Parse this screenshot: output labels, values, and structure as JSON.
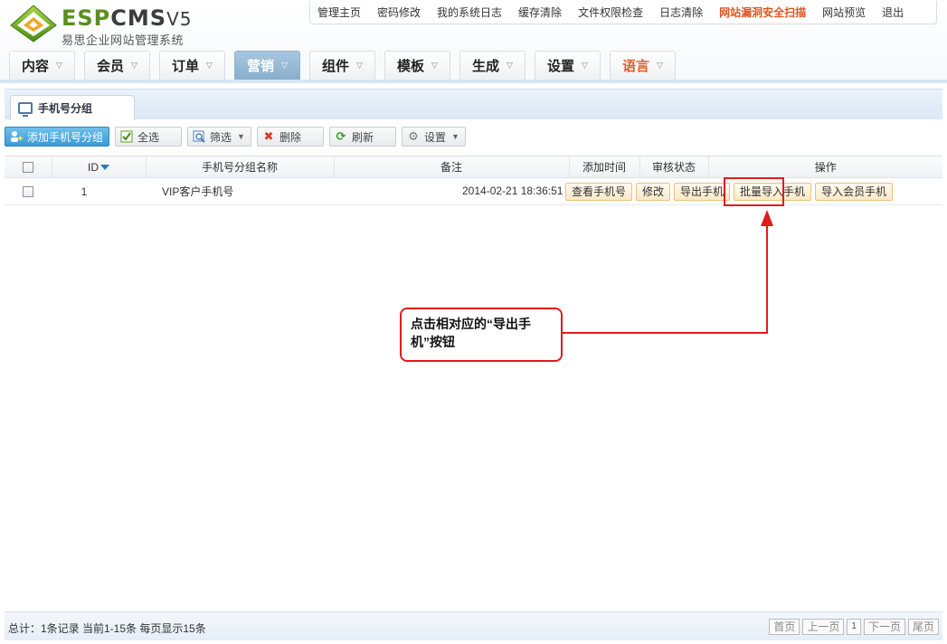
{
  "brand": {
    "logo_main": "ESP",
    "logo_cms": "CMS",
    "logo_ver": "V5",
    "subtitle": "易思企业网站管理系统"
  },
  "topnav": [
    "管理主页",
    "密码修改",
    "我的系统日志",
    "缓存清除",
    "文件权限检查",
    "日志清除",
    "网站漏洞安全扫描",
    "网站预览",
    "退出"
  ],
  "mainnav": {
    "tabs": [
      "内容",
      "会员",
      "订单",
      "营销",
      "组件",
      "模板",
      "生成",
      "设置",
      "语言"
    ],
    "active": "营销"
  },
  "panel": {
    "tab_label": "手机号分组"
  },
  "toolbar": {
    "add": "添加手机号分组",
    "select_all": "全选",
    "filter": "筛选",
    "delete": "删除",
    "refresh": "刷新",
    "settings": "设置"
  },
  "table": {
    "columns": [
      "ID",
      "手机号分组名称",
      "备注",
      "添加时间",
      "审核状态",
      "操作"
    ],
    "rows": [
      {
        "id": "1",
        "name": "VIP客户手机号",
        "remark": "",
        "time": "2014-02-21 18:36:51",
        "actions": [
          "查看手机号",
          "修改",
          "导出手机",
          "批量导入手机",
          "导入会员手机"
        ]
      }
    ]
  },
  "annotation": {
    "text": "点击相对应的“导出手机”按钮"
  },
  "footer": {
    "summary": "总计：1条记录 当前1-15条 每页显示15条",
    "first": "首页",
    "prev": "上一页",
    "page": "1",
    "next": "下一页",
    "last": "尾页"
  },
  "colors": {
    "accent_blue": "#87aecd",
    "highlight_red": "#e01c1c",
    "warn_orange": "#e0531f"
  }
}
